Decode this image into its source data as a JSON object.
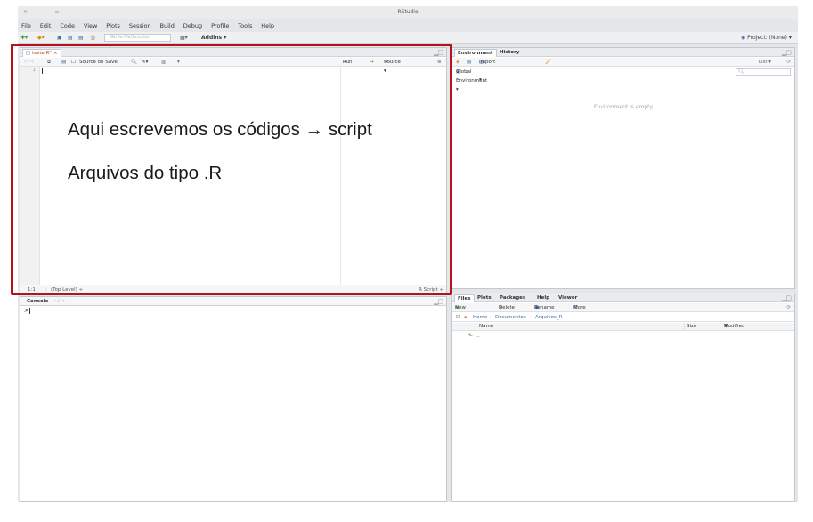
{
  "app": {
    "title": "RStudio",
    "window_controls": [
      "×",
      "–",
      "▫"
    ]
  },
  "menu": [
    "File",
    "Edit",
    "Code",
    "View",
    "Plots",
    "Session",
    "Build",
    "Debug",
    "Profile",
    "Tools",
    "Help"
  ],
  "toolbar": {
    "goto_placeholder": "Go to file/function",
    "addins_label": "Addins ▾",
    "project_label": "Project: (None) ▾"
  },
  "source": {
    "tab_label": "teste.R* ×",
    "source_on_save_label": "Source on Save",
    "run_label": "Run",
    "source_label": "Source ▾",
    "line_number": "1",
    "cursor_position": "1:1",
    "scope": "(Top Level) ÷",
    "file_type": "R Script ÷"
  },
  "annotations": {
    "line1": "Aqui escrevemos os códigos → script",
    "line2": "Arquivos do tipo .R"
  },
  "environment": {
    "tabs": [
      "Environment",
      "History"
    ],
    "import_label": "Import Dataset ▾",
    "list_label": "List ▾",
    "scope_label": "Global Environment ▾",
    "empty_message": "Environment is empty"
  },
  "console": {
    "title": "Console",
    "path": "~/ ⇨",
    "prompt": ">"
  },
  "files": {
    "tabs": [
      "Files",
      "Plots",
      "Packages",
      "Help",
      "Viewer"
    ],
    "new_folder_label": "New Folder",
    "delete_label": "Delete",
    "rename_label": "Rename",
    "more_label": "More ▾",
    "breadcrumb": [
      "Home",
      "Documentos",
      "Arquivos_R"
    ],
    "columns": [
      "Name",
      "Size",
      "Modified"
    ],
    "rows": [
      {
        "name": ".."
      }
    ]
  },
  "colors": {
    "highlight_border": "#b5121b",
    "chrome_bg": "#e4e7ea"
  }
}
